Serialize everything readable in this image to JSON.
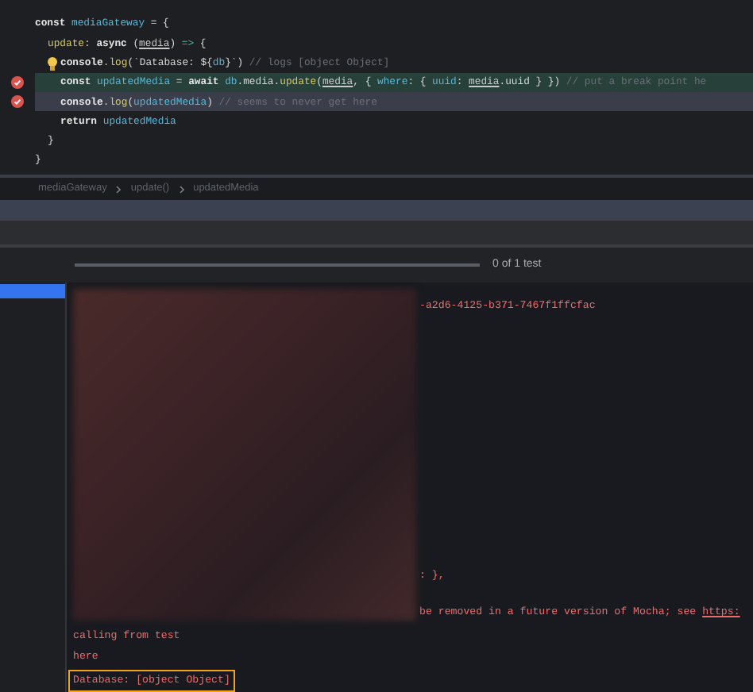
{
  "editor": {
    "lines": [
      {
        "breakpoint": false,
        "bulb": false,
        "executing": false,
        "selected": false,
        "tokens": [
          {
            "kind": "kw",
            "text": "const "
          },
          {
            "kind": "var",
            "text": "mediaGateway"
          },
          {
            "kind": "plain",
            "text": " = {"
          }
        ],
        "children": [
          {
            "breakpoint": false,
            "bulb": false,
            "executing": false,
            "selected": false,
            "tokens": [
              {
                "kind": "fn",
                "text": "update"
              },
              {
                "kind": "plain",
                "text": ": "
              },
              {
                "kind": "kw",
                "text": "async "
              },
              {
                "kind": "plain",
                "text": "("
              },
              {
                "kind": "param",
                "text": "media"
              },
              {
                "kind": "plain",
                "text": ") "
              },
              {
                "kind": "op",
                "text": "=>"
              },
              {
                "kind": "plain",
                "text": " {"
              }
            ],
            "children": [
              {
                "breakpoint": false,
                "bulb": true,
                "executing": false,
                "selected": false,
                "tokens": [
                  {
                    "kind": "kw",
                    "text": "console"
                  },
                  {
                    "kind": "fn",
                    "text": ".log"
                  },
                  {
                    "kind": "str",
                    "text": "(`Database: ${"
                  },
                  {
                    "kind": "var",
                    "text": "db"
                  },
                  {
                    "kind": "str",
                    "text": "}`)"
                  },
                  {
                    "kind": "com",
                    "text": " // logs [object Object]"
                  }
                ]
              },
              {
                "breakpoint": true,
                "bulb": false,
                "executing": true,
                "selected": false,
                "tokens": [
                  {
                    "kind": "kw",
                    "text": "const "
                  },
                  {
                    "kind": "var",
                    "text": "updatedMedia"
                  },
                  {
                    "kind": "plain",
                    "text": " = "
                  },
                  {
                    "kind": "kw",
                    "text": "await "
                  },
                  {
                    "kind": "var",
                    "text": "db"
                  },
                  {
                    "kind": "plain",
                    "text": ".media."
                  },
                  {
                    "kind": "fn",
                    "text": "update"
                  },
                  {
                    "kind": "plain",
                    "text": "("
                  },
                  {
                    "kind": "param",
                    "text": "media"
                  },
                  {
                    "kind": "plain",
                    "text": ", { "
                  },
                  {
                    "kind": "var",
                    "text": "where"
                  },
                  {
                    "kind": "plain",
                    "text": ": { "
                  },
                  {
                    "kind": "var",
                    "text": "uuid"
                  },
                  {
                    "kind": "plain",
                    "text": ": "
                  },
                  {
                    "kind": "param",
                    "text": "media"
                  },
                  {
                    "kind": "plain",
                    "text": ".uuid } })"
                  },
                  {
                    "kind": "com",
                    "text": " // put a break point he"
                  }
                ]
              },
              {
                "breakpoint": true,
                "bulb": false,
                "executing": false,
                "selected": true,
                "tokens": [
                  {
                    "kind": "kw",
                    "text": "console"
                  },
                  {
                    "kind": "fn",
                    "text": ".log"
                  },
                  {
                    "kind": "plain",
                    "text": "("
                  },
                  {
                    "kind": "var",
                    "text": "updatedMedia"
                  },
                  {
                    "kind": "plain",
                    "text": ")"
                  },
                  {
                    "kind": "com",
                    "text": " // seems to never get here"
                  }
                ]
              },
              {
                "breakpoint": false,
                "bulb": false,
                "executing": false,
                "selected": false,
                "tokens": [
                  {
                    "kind": "kw",
                    "text": "return "
                  },
                  {
                    "kind": "var",
                    "text": "updatedMedia"
                  }
                ]
              }
            ]
          },
          {
            "breakpoint": false,
            "bulb": false,
            "executing": false,
            "selected": false,
            "tokens": [
              {
                "kind": "plain",
                "text": "}"
              }
            ]
          }
        ]
      },
      {
        "breakpoint": false,
        "bulb": false,
        "executing": false,
        "selected": false,
        "tokens": [
          {
            "kind": "plain",
            "text": "}"
          }
        ]
      }
    ]
  },
  "breadcrumbs": [
    "mediaGateway",
    "update()",
    "updatedMedia"
  ],
  "test_progress": {
    "level": 0,
    "text": "0 of 1 test"
  },
  "output": {
    "top_right": [
      "-a2d6-4125-b371-7467f1ffcfac"
    ],
    "bottom_right": [
      {
        "text": ": },"
      },
      {
        "text": "be removed in a future version of Mocha; see ",
        "link": "https:"
      }
    ],
    "lines": [
      {
        "kind": "plain",
        "text": "calling from test"
      },
      {
        "kind": "plain",
        "text": "here"
      },
      {
        "kind": "boxed",
        "text": "Database: [object Object]"
      }
    ]
  }
}
